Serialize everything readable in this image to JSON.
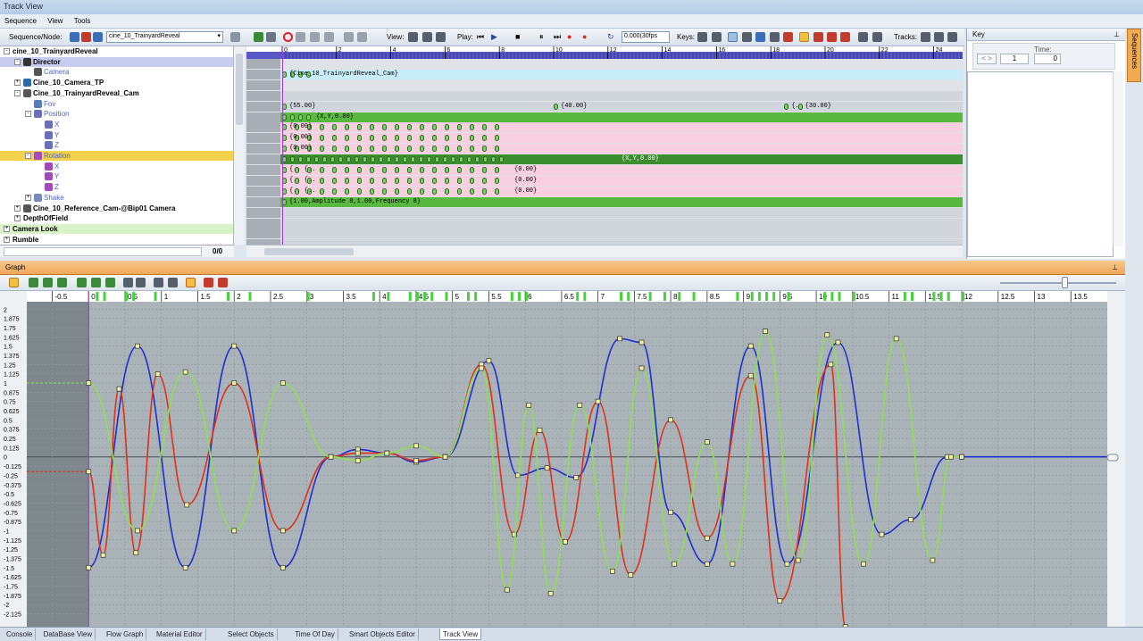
{
  "window": {
    "title": "Track View"
  },
  "menu": [
    "Sequence",
    "View",
    "Tools"
  ],
  "toolbar": {
    "seq_node_label": "Sequence/Node:",
    "sequence_value": "cine_10_TrainyardReveal",
    "view_label": "View:",
    "play_label": "Play:",
    "time_value": "0.000(30fps",
    "keys_label": "Keys:",
    "tracks_label": "Tracks:"
  },
  "key_panel": {
    "title": "Key",
    "time_label": "Time:",
    "key_index": "1",
    "time_value": "0",
    "nav_prev": "<",
    "nav_next": ">"
  },
  "sequences_tab": "Sequences",
  "tree": {
    "items": [
      {
        "label": "cine_10_TrainyardReveal",
        "indent": 0,
        "bold": true,
        "expander": "-",
        "icon": "none",
        "hl": "none"
      },
      {
        "label": "Director",
        "indent": 1,
        "bold": true,
        "expander": "-",
        "icon": "director",
        "hl": "blue"
      },
      {
        "label": "Camera",
        "indent": 2,
        "bold": false,
        "expander": "",
        "icon": "camera",
        "hl": "none",
        "color": "blue"
      },
      {
        "label": "Cine_10_Camera_TP",
        "indent": 1,
        "bold": true,
        "expander": "+",
        "icon": "person",
        "hl": "none"
      },
      {
        "label": "Cine_10_TrainyardReveal_Cam",
        "indent": 1,
        "bold": true,
        "expander": "-",
        "icon": "camera",
        "hl": "none"
      },
      {
        "label": "Fov",
        "indent": 2,
        "bold": false,
        "expander": "",
        "icon": "fov",
        "hl": "none",
        "color": "blue"
      },
      {
        "label": "Position",
        "indent": 2,
        "bold": false,
        "expander": "-",
        "icon": "axis",
        "hl": "none",
        "color": "blue"
      },
      {
        "label": "X",
        "indent": 3,
        "bold": false,
        "expander": "",
        "icon": "axis",
        "hl": "none",
        "color": "blue"
      },
      {
        "label": "Y",
        "indent": 3,
        "bold": false,
        "expander": "",
        "icon": "axis",
        "hl": "none",
        "color": "blue"
      },
      {
        "label": "Z",
        "indent": 3,
        "bold": false,
        "expander": "",
        "icon": "axis",
        "hl": "none",
        "color": "blue"
      },
      {
        "label": "Rotation",
        "indent": 2,
        "bold": false,
        "expander": "-",
        "icon": "rot",
        "hl": "yellow",
        "color": "blue"
      },
      {
        "label": "X",
        "indent": 3,
        "bold": false,
        "expander": "",
        "icon": "rot",
        "hl": "none",
        "color": "blue"
      },
      {
        "label": "Y",
        "indent": 3,
        "bold": false,
        "expander": "",
        "icon": "rot",
        "hl": "none",
        "color": "blue"
      },
      {
        "label": "Z",
        "indent": 3,
        "bold": false,
        "expander": "",
        "icon": "rot",
        "hl": "none",
        "color": "blue"
      },
      {
        "label": "Shake",
        "indent": 2,
        "bold": false,
        "expander": "+",
        "icon": "shake",
        "hl": "none",
        "color": "blue"
      },
      {
        "label": "Cine_10_Reference_Cam-@Bip01 Camera",
        "indent": 1,
        "bold": true,
        "expander": "+",
        "icon": "camera",
        "hl": "none"
      },
      {
        "label": "DepthOfField",
        "indent": 1,
        "bold": true,
        "expander": "+",
        "icon": "none",
        "hl": "none"
      },
      {
        "label": "Camera Look",
        "indent": 0,
        "bold": true,
        "expander": "+",
        "icon": "none",
        "hl": "green"
      },
      {
        "label": "Rumble",
        "indent": 0,
        "bold": true,
        "expander": "+",
        "icon": "none",
        "hl": "none"
      }
    ],
    "footer_count": "0/0"
  },
  "timeline_ruler": [
    "0",
    "2",
    "4",
    "6",
    "8",
    "10",
    "12",
    "14",
    "16",
    "18",
    "20",
    "22",
    "24"
  ],
  "tracks": [
    {
      "type": "blank",
      "text": ""
    },
    {
      "type": "cyan",
      "text": "{Cine_10_TrainyardReveal_Cam}",
      "keys": [
        0
      ]
    },
    {
      "type": "blank",
      "text": ""
    },
    {
      "type": "grey",
      "text": ""
    },
    {
      "type": "grey",
      "text": "",
      "labels": [
        {
          "t": "{55.00}",
          "at": 0
        },
        {
          "t": "{40.00}",
          "at": 10
        },
        {
          "t": "{..",
          "at": 18.5
        },
        {
          "t": "{30.00}",
          "at": 19
        }
      ]
    },
    {
      "type": "green",
      "text": "{X,Y,0.00}"
    },
    {
      "type": "pink",
      "text": "{0.00}"
    },
    {
      "type": "pink",
      "text": "{0.00}"
    },
    {
      "type": "pink",
      "text": "{0.00}"
    },
    {
      "type": "dkgreen",
      "text": "{X,Y,0.00}"
    },
    {
      "type": "pink",
      "text": "{0.00}"
    },
    {
      "type": "pink",
      "text": "{0.00}"
    },
    {
      "type": "pink",
      "text": "{0.00}"
    },
    {
      "type": "green",
      "text": "{1.00,Amplitude 8,1.00,Frequency 8}"
    },
    {
      "type": "grey",
      "text": ""
    },
    {
      "type": "grey",
      "text": ""
    },
    {
      "type": "grey",
      "text": ""
    },
    {
      "type": "grey",
      "text": ""
    }
  ],
  "graph": {
    "title": "Graph",
    "x_ticks": [
      "-0.5",
      "0",
      "0.5",
      "1",
      "1.5",
      "2",
      "2.5",
      "3",
      "3.5",
      "4",
      "4.5",
      "5",
      "5.5",
      "6",
      "6.5",
      "7",
      "7.5",
      "8",
      "8.5",
      "9",
      "9.5",
      "10",
      "10.5",
      "11",
      "11.5",
      "12",
      "12.5",
      "13",
      "13.5"
    ],
    "y_ticks": [
      "2",
      "1.875",
      "1.75",
      "1.625",
      "1.5",
      "1.375",
      "1.25",
      "1.125",
      "1",
      "0.875",
      "0.75",
      "0.625",
      "0.5",
      "0.375",
      "0.25",
      "0.125",
      "0",
      "-0.125",
      "-0.25",
      "-0.375",
      "-0.5",
      "-0.625",
      "-0.75",
      "-0.875",
      "-1",
      "-1.125",
      "-1.25",
      "-1.375",
      "-1.5",
      "-1.625",
      "-1.75",
      "-1.875",
      "-2",
      "-2.125"
    ],
    "colors": {
      "red": "#e0301a",
      "green": "#8ee050",
      "blue": "#1e2fd0"
    }
  },
  "chart_data": {
    "type": "line",
    "xlim": [
      -0.85,
      14.0
    ],
    "ylim": [
      -2.3,
      2.1
    ],
    "series": [
      {
        "color": "#1e2fd0",
        "points": [
          [
            0,
            -1.5
          ],
          [
            0.67,
            1.5
          ],
          [
            1.33,
            -1.5
          ],
          [
            2.0,
            1.5
          ],
          [
            2.67,
            -1.5
          ],
          [
            3.33,
            0
          ],
          [
            3.7,
            0.1
          ],
          [
            4.1,
            0.05
          ],
          [
            4.5,
            -0.07
          ],
          [
            4.9,
            0
          ],
          [
            5.5,
            1.3
          ],
          [
            5.9,
            -0.25
          ],
          [
            6.3,
            -0.15
          ],
          [
            6.7,
            -0.28
          ],
          [
            7.3,
            1.6
          ],
          [
            7.6,
            1.55
          ],
          [
            8.0,
            -0.75
          ],
          [
            8.5,
            -1.45
          ],
          [
            9.1,
            1.5
          ],
          [
            9.6,
            -1.45
          ],
          [
            10.3,
            1.55
          ],
          [
            10.9,
            -1.05
          ],
          [
            11.3,
            -0.85
          ],
          [
            11.8,
            0
          ],
          [
            12.0,
            0
          ],
          [
            14.0,
            0
          ]
        ]
      },
      {
        "color": "#e0301a",
        "points": [
          [
            0,
            -0.2
          ],
          [
            0.2,
            -1.33
          ],
          [
            0.42,
            0.92
          ],
          [
            0.65,
            -1.3
          ],
          [
            0.95,
            1.12
          ],
          [
            1.35,
            -0.65
          ],
          [
            2.0,
            1.0
          ],
          [
            2.67,
            -1.0
          ],
          [
            3.33,
            0
          ],
          [
            3.7,
            0.05
          ],
          [
            4.1,
            0.05
          ],
          [
            4.5,
            -0.05
          ],
          [
            4.9,
            0
          ],
          [
            5.4,
            1.25
          ],
          [
            5.85,
            -1.05
          ],
          [
            6.2,
            0.36
          ],
          [
            6.55,
            -1.15
          ],
          [
            7.0,
            0.75
          ],
          [
            7.45,
            -1.6
          ],
          [
            8.0,
            0.5
          ],
          [
            8.5,
            -1.1
          ],
          [
            9.1,
            1.1
          ],
          [
            9.5,
            -1.95
          ],
          [
            10.2,
            1.25
          ],
          [
            10.4,
            -2.3
          ]
        ]
      },
      {
        "color": "#8ee050",
        "points": [
          [
            0,
            1.0
          ],
          [
            0.67,
            -1.0
          ],
          [
            1.33,
            1.15
          ],
          [
            2.0,
            -1.0
          ],
          [
            2.67,
            1.0
          ],
          [
            3.33,
            0
          ],
          [
            3.7,
            -0.05
          ],
          [
            4.1,
            0.05
          ],
          [
            4.5,
            0.15
          ],
          [
            4.9,
            0
          ],
          [
            5.4,
            1.2
          ],
          [
            5.75,
            -1.8
          ],
          [
            6.05,
            0.7
          ],
          [
            6.35,
            -1.85
          ],
          [
            6.75,
            0.7
          ],
          [
            7.2,
            -1.55
          ],
          [
            7.6,
            1.2
          ],
          [
            8.05,
            -1.45
          ],
          [
            8.5,
            0.2
          ],
          [
            8.85,
            -1.45
          ],
          [
            9.3,
            1.7
          ],
          [
            9.75,
            -1.4
          ],
          [
            10.15,
            1.65
          ],
          [
            10.65,
            -1.45
          ],
          [
            11.1,
            1.6
          ],
          [
            11.6,
            -1.4
          ],
          [
            11.85,
            0
          ],
          [
            12.0,
            0
          ]
        ]
      }
    ]
  },
  "bottom_tabs": [
    "Console",
    "DataBase View",
    "Flow Graph",
    "Material Editor",
    "Select Objects",
    "Time Of Day",
    "Smart Objects Editor",
    "Track View"
  ],
  "active_tab": "Track View"
}
